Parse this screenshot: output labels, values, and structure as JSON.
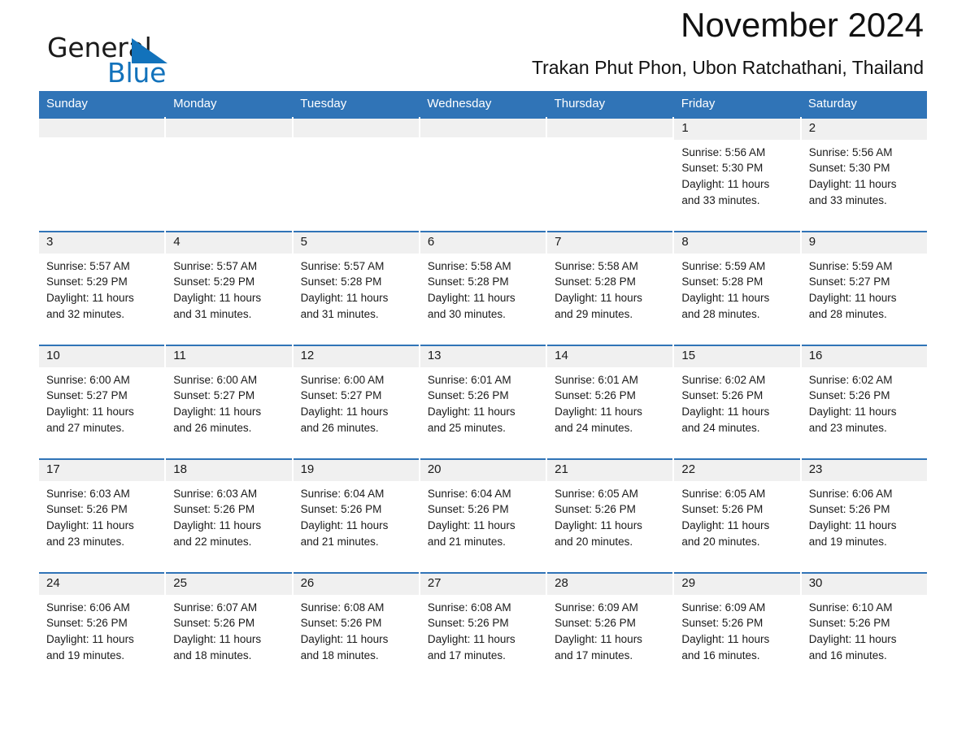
{
  "brand": {
    "name_part1": "General",
    "name_part2": "Blue",
    "triangle_color": "#1272bb"
  },
  "header": {
    "month_title": "November 2024",
    "location": "Trakan Phut Phon, Ubon Ratchathani, Thailand",
    "header_bg": "#3074b7",
    "row_divider_color": "#3074b7",
    "day_band_bg": "#f0f0f0"
  },
  "weekdays": [
    "Sunday",
    "Monday",
    "Tuesday",
    "Wednesday",
    "Thursday",
    "Friday",
    "Saturday"
  ],
  "weeks": [
    [
      {
        "day": "",
        "sunrise": "",
        "sunset": "",
        "daylight_line1": "",
        "daylight_line2": ""
      },
      {
        "day": "",
        "sunrise": "",
        "sunset": "",
        "daylight_line1": "",
        "daylight_line2": ""
      },
      {
        "day": "",
        "sunrise": "",
        "sunset": "",
        "daylight_line1": "",
        "daylight_line2": ""
      },
      {
        "day": "",
        "sunrise": "",
        "sunset": "",
        "daylight_line1": "",
        "daylight_line2": ""
      },
      {
        "day": "",
        "sunrise": "",
        "sunset": "",
        "daylight_line1": "",
        "daylight_line2": ""
      },
      {
        "day": "1",
        "sunrise": "Sunrise: 5:56 AM",
        "sunset": "Sunset: 5:30 PM",
        "daylight_line1": "Daylight: 11 hours",
        "daylight_line2": "and 33 minutes."
      },
      {
        "day": "2",
        "sunrise": "Sunrise: 5:56 AM",
        "sunset": "Sunset: 5:30 PM",
        "daylight_line1": "Daylight: 11 hours",
        "daylight_line2": "and 33 minutes."
      }
    ],
    [
      {
        "day": "3",
        "sunrise": "Sunrise: 5:57 AM",
        "sunset": "Sunset: 5:29 PM",
        "daylight_line1": "Daylight: 11 hours",
        "daylight_line2": "and 32 minutes."
      },
      {
        "day": "4",
        "sunrise": "Sunrise: 5:57 AM",
        "sunset": "Sunset: 5:29 PM",
        "daylight_line1": "Daylight: 11 hours",
        "daylight_line2": "and 31 minutes."
      },
      {
        "day": "5",
        "sunrise": "Sunrise: 5:57 AM",
        "sunset": "Sunset: 5:28 PM",
        "daylight_line1": "Daylight: 11 hours",
        "daylight_line2": "and 31 minutes."
      },
      {
        "day": "6",
        "sunrise": "Sunrise: 5:58 AM",
        "sunset": "Sunset: 5:28 PM",
        "daylight_line1": "Daylight: 11 hours",
        "daylight_line2": "and 30 minutes."
      },
      {
        "day": "7",
        "sunrise": "Sunrise: 5:58 AM",
        "sunset": "Sunset: 5:28 PM",
        "daylight_line1": "Daylight: 11 hours",
        "daylight_line2": "and 29 minutes."
      },
      {
        "day": "8",
        "sunrise": "Sunrise: 5:59 AM",
        "sunset": "Sunset: 5:28 PM",
        "daylight_line1": "Daylight: 11 hours",
        "daylight_line2": "and 28 minutes."
      },
      {
        "day": "9",
        "sunrise": "Sunrise: 5:59 AM",
        "sunset": "Sunset: 5:27 PM",
        "daylight_line1": "Daylight: 11 hours",
        "daylight_line2": "and 28 minutes."
      }
    ],
    [
      {
        "day": "10",
        "sunrise": "Sunrise: 6:00 AM",
        "sunset": "Sunset: 5:27 PM",
        "daylight_line1": "Daylight: 11 hours",
        "daylight_line2": "and 27 minutes."
      },
      {
        "day": "11",
        "sunrise": "Sunrise: 6:00 AM",
        "sunset": "Sunset: 5:27 PM",
        "daylight_line1": "Daylight: 11 hours",
        "daylight_line2": "and 26 minutes."
      },
      {
        "day": "12",
        "sunrise": "Sunrise: 6:00 AM",
        "sunset": "Sunset: 5:27 PM",
        "daylight_line1": "Daylight: 11 hours",
        "daylight_line2": "and 26 minutes."
      },
      {
        "day": "13",
        "sunrise": "Sunrise: 6:01 AM",
        "sunset": "Sunset: 5:26 PM",
        "daylight_line1": "Daylight: 11 hours",
        "daylight_line2": "and 25 minutes."
      },
      {
        "day": "14",
        "sunrise": "Sunrise: 6:01 AM",
        "sunset": "Sunset: 5:26 PM",
        "daylight_line1": "Daylight: 11 hours",
        "daylight_line2": "and 24 minutes."
      },
      {
        "day": "15",
        "sunrise": "Sunrise: 6:02 AM",
        "sunset": "Sunset: 5:26 PM",
        "daylight_line1": "Daylight: 11 hours",
        "daylight_line2": "and 24 minutes."
      },
      {
        "day": "16",
        "sunrise": "Sunrise: 6:02 AM",
        "sunset": "Sunset: 5:26 PM",
        "daylight_line1": "Daylight: 11 hours",
        "daylight_line2": "and 23 minutes."
      }
    ],
    [
      {
        "day": "17",
        "sunrise": "Sunrise: 6:03 AM",
        "sunset": "Sunset: 5:26 PM",
        "daylight_line1": "Daylight: 11 hours",
        "daylight_line2": "and 23 minutes."
      },
      {
        "day": "18",
        "sunrise": "Sunrise: 6:03 AM",
        "sunset": "Sunset: 5:26 PM",
        "daylight_line1": "Daylight: 11 hours",
        "daylight_line2": "and 22 minutes."
      },
      {
        "day": "19",
        "sunrise": "Sunrise: 6:04 AM",
        "sunset": "Sunset: 5:26 PM",
        "daylight_line1": "Daylight: 11 hours",
        "daylight_line2": "and 21 minutes."
      },
      {
        "day": "20",
        "sunrise": "Sunrise: 6:04 AM",
        "sunset": "Sunset: 5:26 PM",
        "daylight_line1": "Daylight: 11 hours",
        "daylight_line2": "and 21 minutes."
      },
      {
        "day": "21",
        "sunrise": "Sunrise: 6:05 AM",
        "sunset": "Sunset: 5:26 PM",
        "daylight_line1": "Daylight: 11 hours",
        "daylight_line2": "and 20 minutes."
      },
      {
        "day": "22",
        "sunrise": "Sunrise: 6:05 AM",
        "sunset": "Sunset: 5:26 PM",
        "daylight_line1": "Daylight: 11 hours",
        "daylight_line2": "and 20 minutes."
      },
      {
        "day": "23",
        "sunrise": "Sunrise: 6:06 AM",
        "sunset": "Sunset: 5:26 PM",
        "daylight_line1": "Daylight: 11 hours",
        "daylight_line2": "and 19 minutes."
      }
    ],
    [
      {
        "day": "24",
        "sunrise": "Sunrise: 6:06 AM",
        "sunset": "Sunset: 5:26 PM",
        "daylight_line1": "Daylight: 11 hours",
        "daylight_line2": "and 19 minutes."
      },
      {
        "day": "25",
        "sunrise": "Sunrise: 6:07 AM",
        "sunset": "Sunset: 5:26 PM",
        "daylight_line1": "Daylight: 11 hours",
        "daylight_line2": "and 18 minutes."
      },
      {
        "day": "26",
        "sunrise": "Sunrise: 6:08 AM",
        "sunset": "Sunset: 5:26 PM",
        "daylight_line1": "Daylight: 11 hours",
        "daylight_line2": "and 18 minutes."
      },
      {
        "day": "27",
        "sunrise": "Sunrise: 6:08 AM",
        "sunset": "Sunset: 5:26 PM",
        "daylight_line1": "Daylight: 11 hours",
        "daylight_line2": "and 17 minutes."
      },
      {
        "day": "28",
        "sunrise": "Sunrise: 6:09 AM",
        "sunset": "Sunset: 5:26 PM",
        "daylight_line1": "Daylight: 11 hours",
        "daylight_line2": "and 17 minutes."
      },
      {
        "day": "29",
        "sunrise": "Sunrise: 6:09 AM",
        "sunset": "Sunset: 5:26 PM",
        "daylight_line1": "Daylight: 11 hours",
        "daylight_line2": "and 16 minutes."
      },
      {
        "day": "30",
        "sunrise": "Sunrise: 6:10 AM",
        "sunset": "Sunset: 5:26 PM",
        "daylight_line1": "Daylight: 11 hours",
        "daylight_line2": "and 16 minutes."
      }
    ]
  ]
}
